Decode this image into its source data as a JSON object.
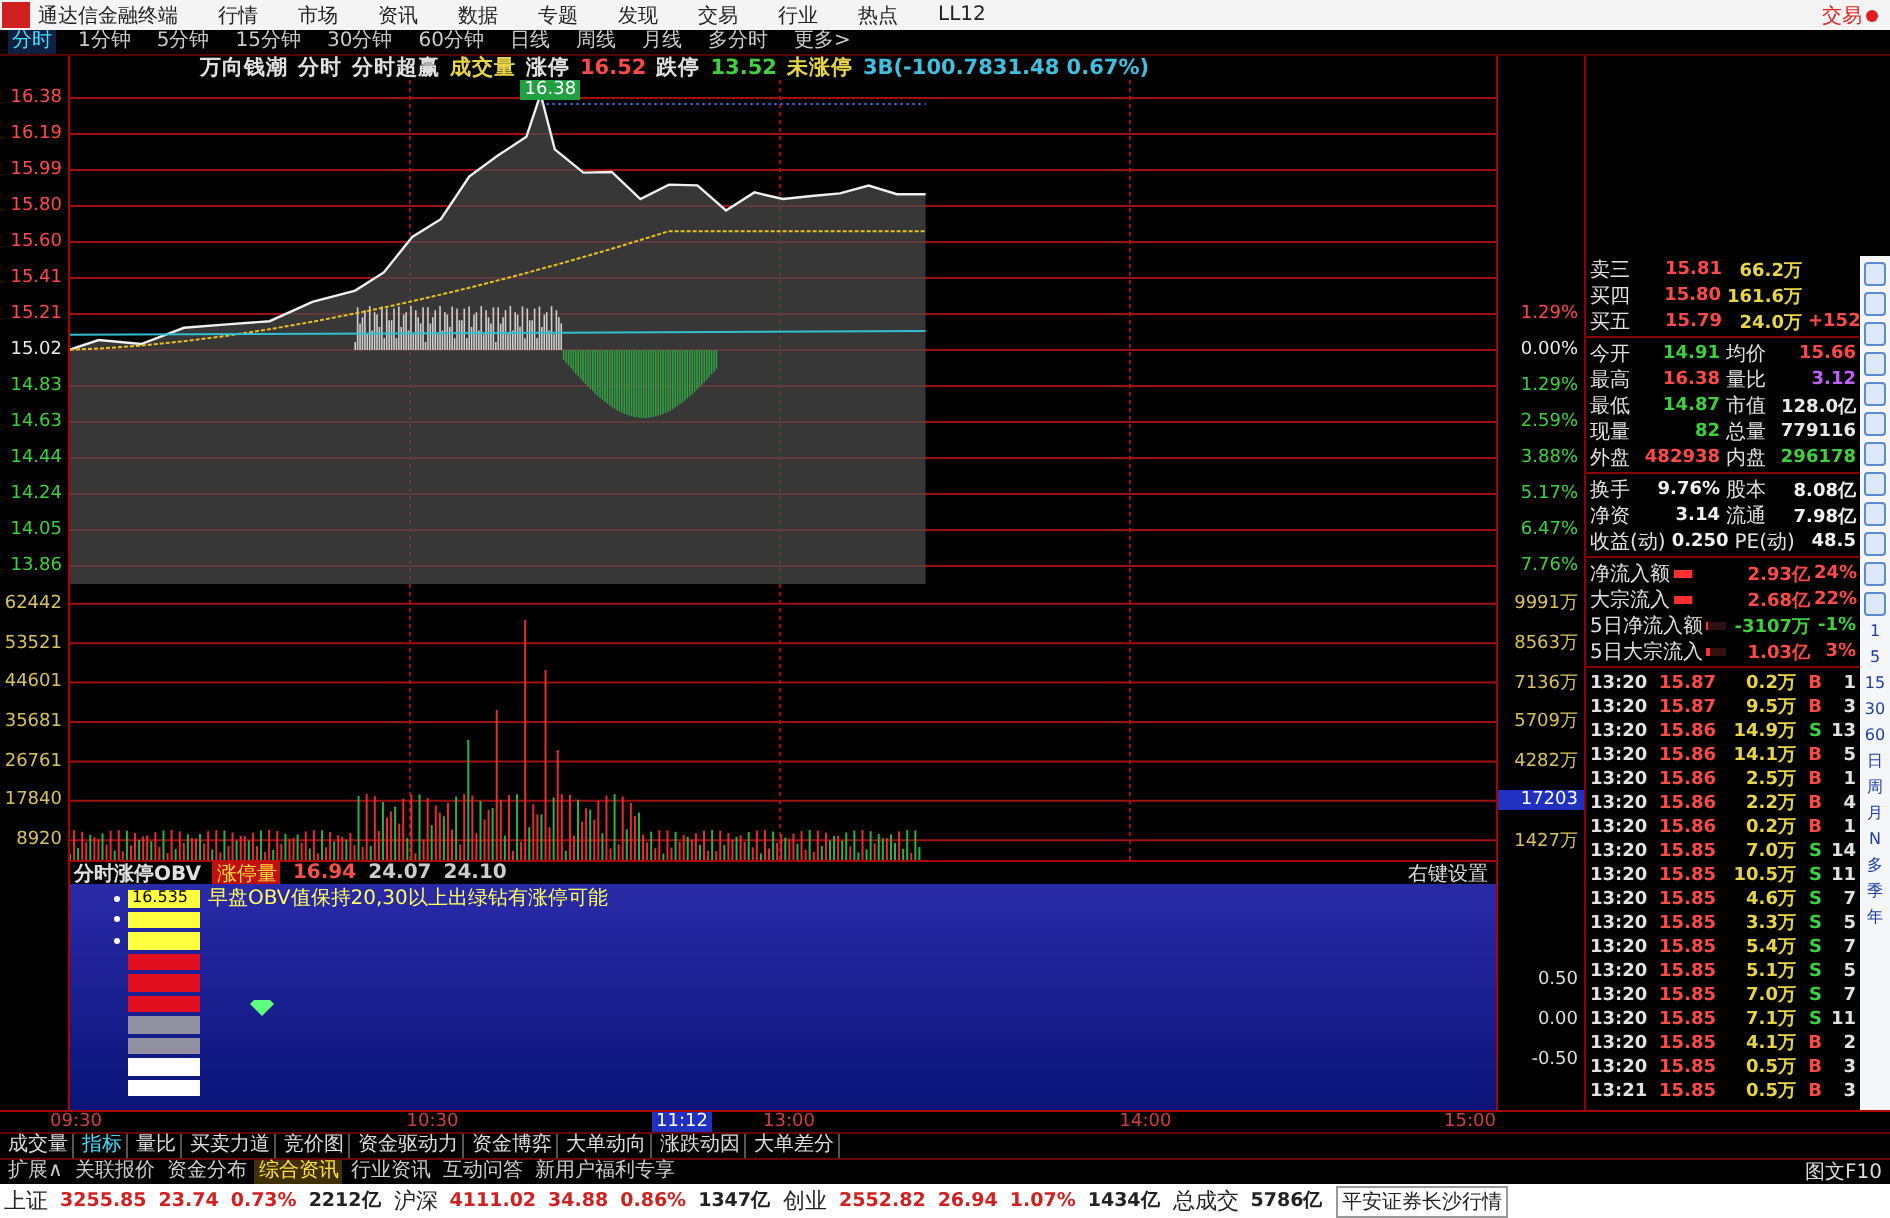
{
  "menu_bar": {
    "app_title": "通达信金融终端",
    "items": [
      "行情",
      "市场",
      "资讯",
      "数据",
      "专题",
      "发现",
      "交易",
      "行业",
      "热点",
      "LL12"
    ],
    "trade_button": "交易"
  },
  "period_tabs": [
    {
      "label": "分时",
      "selected": true
    },
    {
      "label": "1分钟",
      "selected": false
    },
    {
      "label": "5分钟",
      "selected": false
    },
    {
      "label": "15分钟",
      "selected": false
    },
    {
      "label": "30分钟",
      "selected": false
    },
    {
      "label": "60分钟",
      "selected": false
    },
    {
      "label": "日线",
      "selected": false
    },
    {
      "label": "周线",
      "selected": false
    },
    {
      "label": "月线",
      "selected": false
    },
    {
      "label": "多分时",
      "selected": false
    },
    {
      "label": "更多>",
      "selected": false
    }
  ],
  "chart_header": {
    "stock": "万向钱潮",
    "items": [
      {
        "text": "分时",
        "color": "#e0e0e0"
      },
      {
        "text": "分时超赢",
        "color": "#e0e0e0"
      },
      {
        "text": "成交量",
        "color": "#e8d44a"
      },
      {
        "text": "涨停",
        "color": "#e0e0e0"
      },
      {
        "text": "16.52",
        "color": "#ff4a4a"
      },
      {
        "text": "跌停",
        "color": "#e0e0e0"
      },
      {
        "text": "13.52",
        "color": "#40d040"
      },
      {
        "text": "未涨停",
        "color": "#e8d44a"
      },
      {
        "text": "3B(-100.7831.48 0.67%)",
        "color": "#40c0e0"
      }
    ]
  },
  "price_chart": {
    "high_label": "16.38"
  },
  "left_axis": {
    "prices": [
      {
        "text": "16.38",
        "color": "#ff4a4a"
      },
      {
        "text": "16.19",
        "color": "#ff4a4a"
      },
      {
        "text": "15.99",
        "color": "#ff4a4a"
      },
      {
        "text": "15.80",
        "color": "#ff4a4a"
      },
      {
        "text": "15.60",
        "color": "#ff4a4a"
      },
      {
        "text": "15.41",
        "color": "#ff4a4a"
      },
      {
        "text": "15.21",
        "color": "#ff4a4a"
      },
      {
        "text": "15.02",
        "color": "#e8e8e8"
      },
      {
        "text": "14.83",
        "color": "#3ed03e"
      },
      {
        "text": "14.63",
        "color": "#3ed03e"
      },
      {
        "text": "14.44",
        "color": "#3ed03e"
      },
      {
        "text": "14.24",
        "color": "#3ed03e"
      },
      {
        "text": "14.05",
        "color": "#3ed03e"
      },
      {
        "text": "13.86",
        "color": "#3ed03e"
      }
    ],
    "volumes": [
      "62442",
      "53521",
      "44601",
      "35681",
      "26761",
      "17840",
      "8920"
    ]
  },
  "right_axis": {
    "percents": [
      {
        "text": "1.29%",
        "color": "#ff4a4a"
      },
      {
        "text": "0.00%",
        "color": "#e8e8e8"
      },
      {
        "text": "1.29%",
        "color": "#3ed03e"
      },
      {
        "text": "2.59%",
        "color": "#3ed03e"
      },
      {
        "text": "3.88%",
        "color": "#3ed03e"
      },
      {
        "text": "5.17%",
        "color": "#3ed03e"
      },
      {
        "text": "6.47%",
        "color": "#3ed03e"
      },
      {
        "text": "7.76%",
        "color": "#3ed03e"
      }
    ],
    "volumes": [
      {
        "text": "9991万",
        "highlighted": false
      },
      {
        "text": "8563万",
        "highlighted": false
      },
      {
        "text": "7136万",
        "highlighted": false
      },
      {
        "text": "5709万",
        "highlighted": false
      },
      {
        "text": "4282万",
        "highlighted": false
      },
      {
        "text": "17203",
        "highlighted": true
      },
      {
        "text": "1427万",
        "highlighted": false
      }
    ],
    "indicator": [
      "0.50",
      "0.00",
      "-0.50"
    ]
  },
  "indicator_panel": {
    "title": "分时涨停OBV",
    "tag": "涨停量",
    "values": [
      "16.94",
      "24.07",
      "24.10"
    ],
    "settings": "右键设置",
    "first_value": "16.535",
    "message": "早盘OBV值保持20,30以上出绿钻有涨停可能",
    "markers": [
      {
        "color": "#ffff40",
        "dot": true
      },
      {
        "color": "#ffff40",
        "dot": true
      },
      {
        "color": "#ffff40",
        "dot": true
      },
      {
        "color": "#e01020",
        "dot": false
      },
      {
        "color": "#e01020",
        "dot": false
      },
      {
        "color": "#e01020",
        "dot": false
      },
      {
        "color": "#9090a0",
        "dot": false
      },
      {
        "color": "#9090a0",
        "dot": false
      },
      {
        "color": "#ffffff",
        "dot": false
      },
      {
        "color": "#ffffff",
        "dot": false
      }
    ]
  },
  "time_axis": [
    {
      "text": "09:30",
      "cursor": false
    },
    {
      "text": "10:30",
      "cursor": false
    },
    {
      "text": "11:12",
      "cursor": true
    },
    {
      "text": "13:00",
      "cursor": false
    },
    {
      "text": "14:00",
      "cursor": false
    },
    {
      "text": "15:00",
      "cursor": false
    }
  ],
  "quote_panel": {
    "order_book": [
      {
        "label": "卖三",
        "price": "15.81",
        "volume": "66.2万"
      },
      {
        "label": "买四",
        "price": "15.80",
        "volume": "161.6万"
      },
      {
        "label": "买五",
        "price": "15.79",
        "volume": "24.0万",
        "extra": "+152"
      }
    ],
    "stats": [
      {
        "cells": [
          {
            "label": "今开",
            "value": "14.91",
            "color": "#3ed03e"
          },
          {
            "label": "均价",
            "value": "15.66",
            "color": "#ff4a4a"
          }
        ]
      },
      {
        "cells": [
          {
            "label": "最高",
            "value": "16.38",
            "color": "#ff4a4a"
          },
          {
            "label": "量比",
            "value": "3.12",
            "color": "#c060ff"
          }
        ]
      },
      {
        "cells": [
          {
            "label": "最低",
            "value": "14.87",
            "color": "#3ed03e"
          },
          {
            "label": "市值",
            "value": "128.0亿",
            "color": "#e8e8e8"
          }
        ]
      },
      {
        "cells": [
          {
            "label": "现量",
            "value": "82",
            "color": "#3ed03e"
          },
          {
            "label": "总量",
            "value": "779116",
            "color": "#e8e8e8"
          }
        ]
      },
      {
        "cells": [
          {
            "label": "外盘",
            "value": "482938",
            "color": "#ff4a4a"
          },
          {
            "label": "内盘",
            "value": "296178",
            "color": "#3ed03e"
          }
        ]
      }
    ],
    "finance": [
      {
        "label1": "换手",
        "value1": "9.76%",
        "label2": "股本",
        "value2": "8.08亿"
      },
      {
        "label1": "净资",
        "value1": "3.14",
        "label2": "流通",
        "value2": "7.98亿"
      },
      {
        "label1": "收益(动)",
        "value1": "0.250",
        "label2": "PE(动)",
        "value2": "48.5"
      }
    ],
    "flows": [
      {
        "label": "净流入额",
        "value": "2.93亿",
        "percent": "24%",
        "level": 0.9
      },
      {
        "label": "大宗流入",
        "value": "2.68亿",
        "percent": "22%",
        "level": 0.85
      },
      {
        "label": "5日净流入额",
        "value": "-3107万",
        "percent": "-1%",
        "level": 0.05
      },
      {
        "label": "5日大宗流入",
        "value": "1.03亿",
        "percent": "3%",
        "level": 0.15
      }
    ],
    "trades": [
      {
        "time": "13:20",
        "price": "15.87",
        "volume": "0.2万",
        "side": "B",
        "count": "1"
      },
      {
        "time": "13:20",
        "price": "15.87",
        "volume": "9.5万",
        "side": "B",
        "count": "3"
      },
      {
        "time": "13:20",
        "price": "15.86",
        "volume": "14.9万",
        "side": "S",
        "count": "13"
      },
      {
        "time": "13:20",
        "price": "15.86",
        "volume": "14.1万",
        "side": "B",
        "count": "5"
      },
      {
        "time": "13:20",
        "price": "15.86",
        "volume": "2.5万",
        "side": "B",
        "count": "1"
      },
      {
        "time": "13:20",
        "price": "15.86",
        "volume": "2.2万",
        "side": "B",
        "count": "4"
      },
      {
        "time": "13:20",
        "price": "15.86",
        "volume": "0.2万",
        "side": "B",
        "count": "1"
      },
      {
        "time": "13:20",
        "price": "15.85",
        "volume": "7.0万",
        "side": "S",
        "count": "14"
      },
      {
        "time": "13:20",
        "price": "15.85",
        "volume": "10.5万",
        "side": "S",
        "count": "11"
      },
      {
        "time": "13:20",
        "price": "15.85",
        "volume": "4.6万",
        "side": "S",
        "count": "7"
      },
      {
        "time": "13:20",
        "price": "15.85",
        "volume": "3.3万",
        "side": "S",
        "count": "5"
      },
      {
        "time": "13:20",
        "price": "15.85",
        "volume": "5.4万",
        "side": "S",
        "count": "7"
      },
      {
        "time": "13:20",
        "price": "15.85",
        "volume": "5.1万",
        "side": "S",
        "count": "5"
      },
      {
        "time": "13:20",
        "price": "15.85",
        "volume": "7.0万",
        "side": "S",
        "count": "7"
      },
      {
        "time": "13:20",
        "price": "15.85",
        "volume": "7.1万",
        "side": "S",
        "count": "11"
      },
      {
        "time": "13:20",
        "price": "15.85",
        "volume": "4.1万",
        "side": "B",
        "count": "2"
      },
      {
        "time": "13:20",
        "price": "15.85",
        "volume": "0.5万",
        "side": "B",
        "count": "3"
      },
      {
        "time": "13:21",
        "price": "15.85",
        "volume": "0.5万",
        "side": "B",
        "count": "3"
      }
    ]
  },
  "side_toolbar": {
    "periods": [
      "1",
      "5",
      "15",
      "30",
      "60",
      "日",
      "周",
      "月",
      "N",
      "多",
      "季",
      "年"
    ]
  },
  "bottom_tabs": [
    {
      "label": "成交量",
      "selected": false
    },
    {
      "label": "指标",
      "selected": true
    },
    {
      "label": "量比",
      "selected": false
    },
    {
      "label": "买卖力道",
      "selected": false
    },
    {
      "label": "竞价图",
      "selected": false
    },
    {
      "label": "资金驱动力",
      "selected": false
    },
    {
      "label": "资金博弈",
      "selected": false
    },
    {
      "label": "大单动向",
      "selected": false
    },
    {
      "label": "涨跌动因",
      "selected": false
    },
    {
      "label": "大单差分",
      "selected": false
    }
  ],
  "info_tabs": {
    "items": [
      {
        "label": "扩展∧",
        "selected": false
      },
      {
        "label": "关联报价",
        "selected": false
      },
      {
        "label": "资金分布",
        "selected": false
      },
      {
        "label": "综合资讯",
        "selected": true
      },
      {
        "label": "行业资讯",
        "selected": false
      },
      {
        "label": "互动问答",
        "selected": false
      },
      {
        "label": "新用户福利专享",
        "selected": false
      }
    ],
    "right": "图文F10"
  },
  "status_bar": {
    "indexes": [
      {
        "name": "上证",
        "value": "3255.85",
        "change": "23.74",
        "percent": "0.73%",
        "amount": "2212亿"
      },
      {
        "name": "沪深",
        "value": "4111.02",
        "change": "34.88",
        "percent": "0.86%",
        "amount": "1347亿"
      },
      {
        "name": "创业",
        "value": "2552.82",
        "change": "26.94",
        "percent": "1.07%",
        "amount": "1434亿"
      }
    ],
    "total_label": "总成交",
    "total": "5786亿",
    "broker": "平安证券长沙行情"
  }
}
